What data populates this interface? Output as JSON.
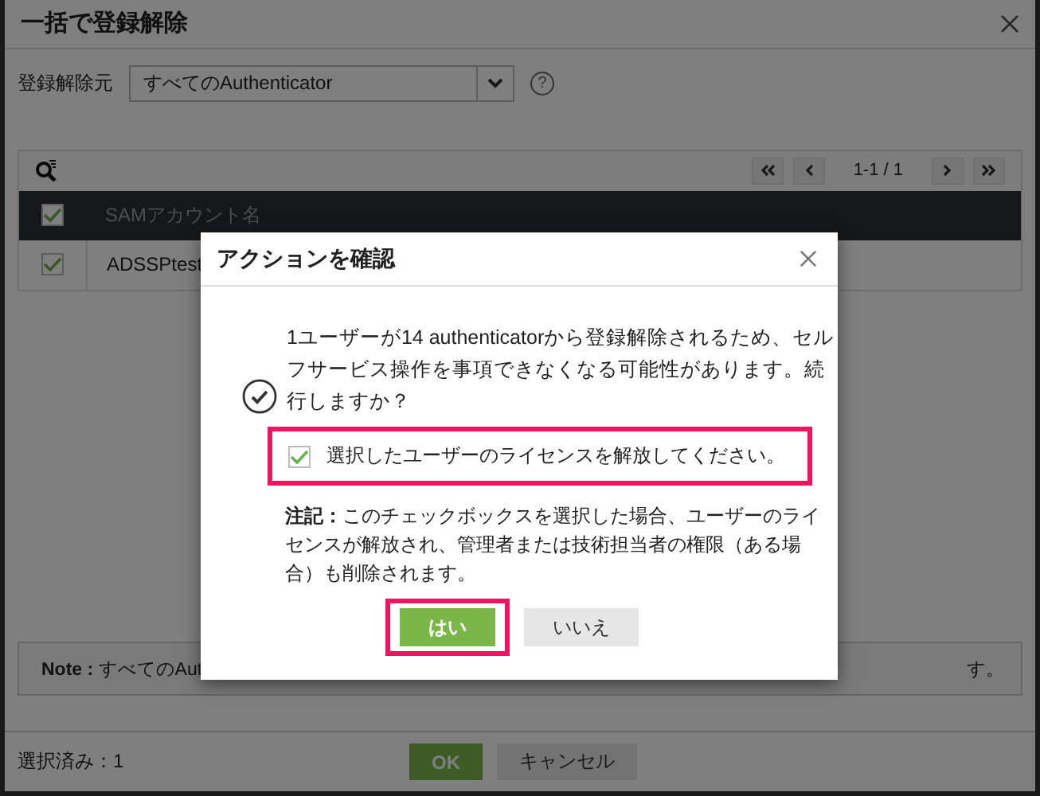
{
  "dialog": {
    "title": "一括で登録解除",
    "unregister_from": {
      "label": "登録解除元",
      "value": "すべてのAuthenticator",
      "help": "?"
    },
    "pager": {
      "range": "1-1 / 1"
    },
    "table": {
      "columns": [
        {
          "label": "SAMアカウント名"
        }
      ],
      "header_checked": true,
      "rows": [
        {
          "checked": true,
          "sam_account": "ADSSPtest"
        }
      ]
    },
    "note": {
      "text": "**Note :** すべてのAut",
      "tail": "す。"
    },
    "footer": {
      "selected_count": "選択済み：1",
      "buttons": [
        {
          "label": "OK",
          "kind": "primary"
        },
        {
          "label": "キャンセル",
          "kind": "secondary"
        }
      ]
    }
  },
  "confirm": {
    "title": "アクションを確認",
    "message": "1ユーザーが14 authenticatorから登録解除されるため、セルフサービス操作を事項できなくなる可能性があります。続行しますか？",
    "checkbox": {
      "label": "選択したユーザーのライセンスを解放してください。",
      "checked": true,
      "highlighted": true
    },
    "note": "**注記：**このチェックボックスを選択した場合、ユーザーのライセンスが解放され、管理者または技術担当者の権限（ある場合）も削除されます。",
    "buttons": [
      {
        "label": "はい",
        "kind": "primary",
        "highlighted": true
      },
      {
        "label": "いいえ",
        "kind": "secondary",
        "highlighted": false
      }
    ]
  }
}
